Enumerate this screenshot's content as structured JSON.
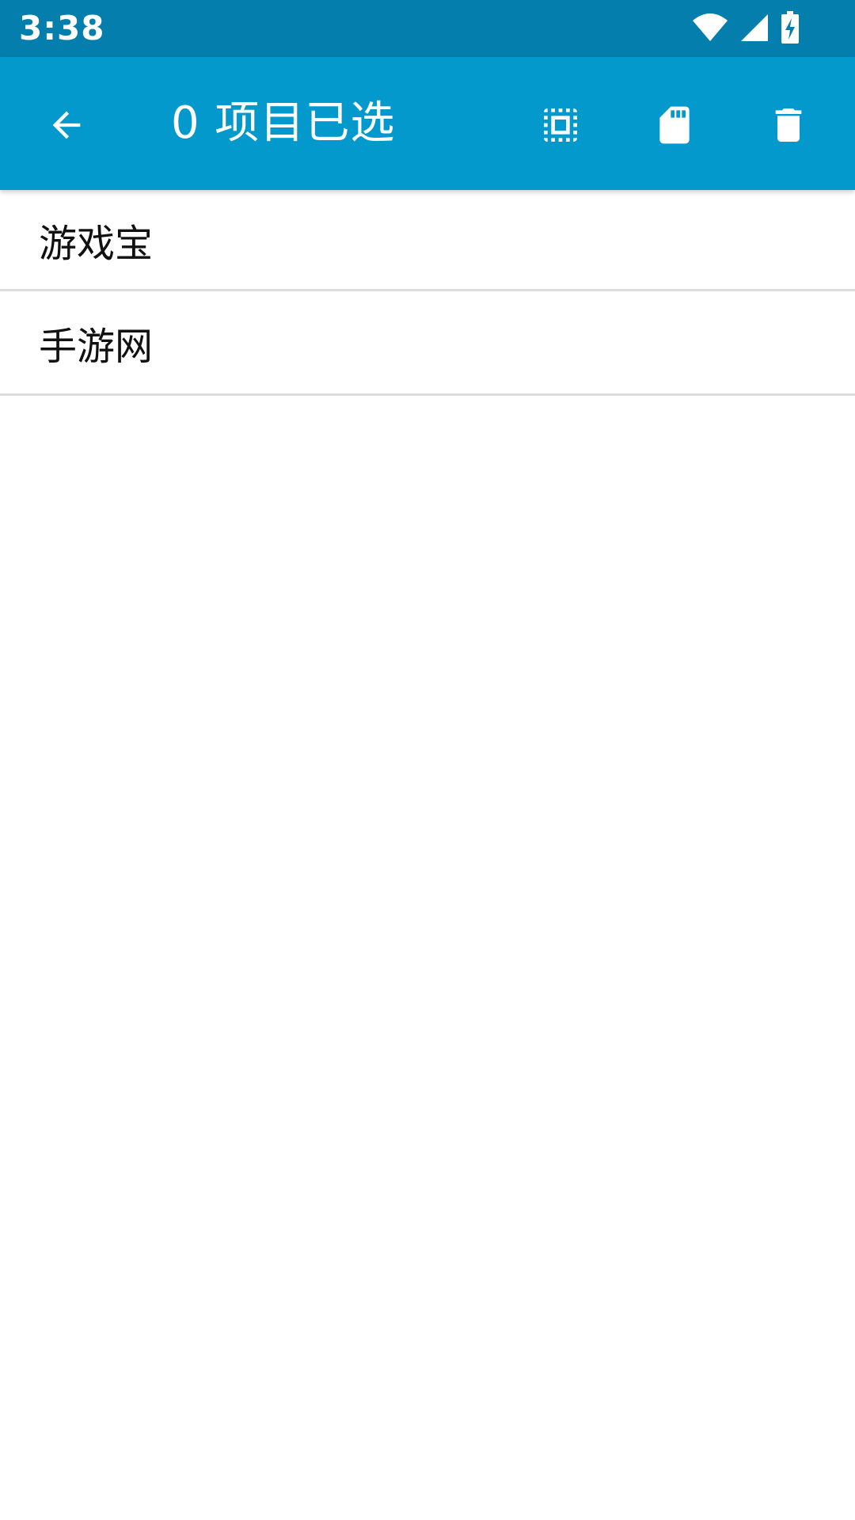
{
  "status_bar": {
    "time": "3:38",
    "icons": [
      "wifi-icon",
      "signal-icon",
      "battery-charging-icon"
    ],
    "background": "#047fad"
  },
  "app_bar": {
    "title": "0 项目已选",
    "background": "#0399cc",
    "back_icon": "arrow-back-icon",
    "actions": [
      {
        "icon": "select-all-icon"
      },
      {
        "icon": "sd-card-icon"
      },
      {
        "icon": "delete-icon"
      }
    ]
  },
  "list": {
    "items": [
      {
        "label": "游戏宝"
      },
      {
        "label": "手游网"
      }
    ]
  }
}
